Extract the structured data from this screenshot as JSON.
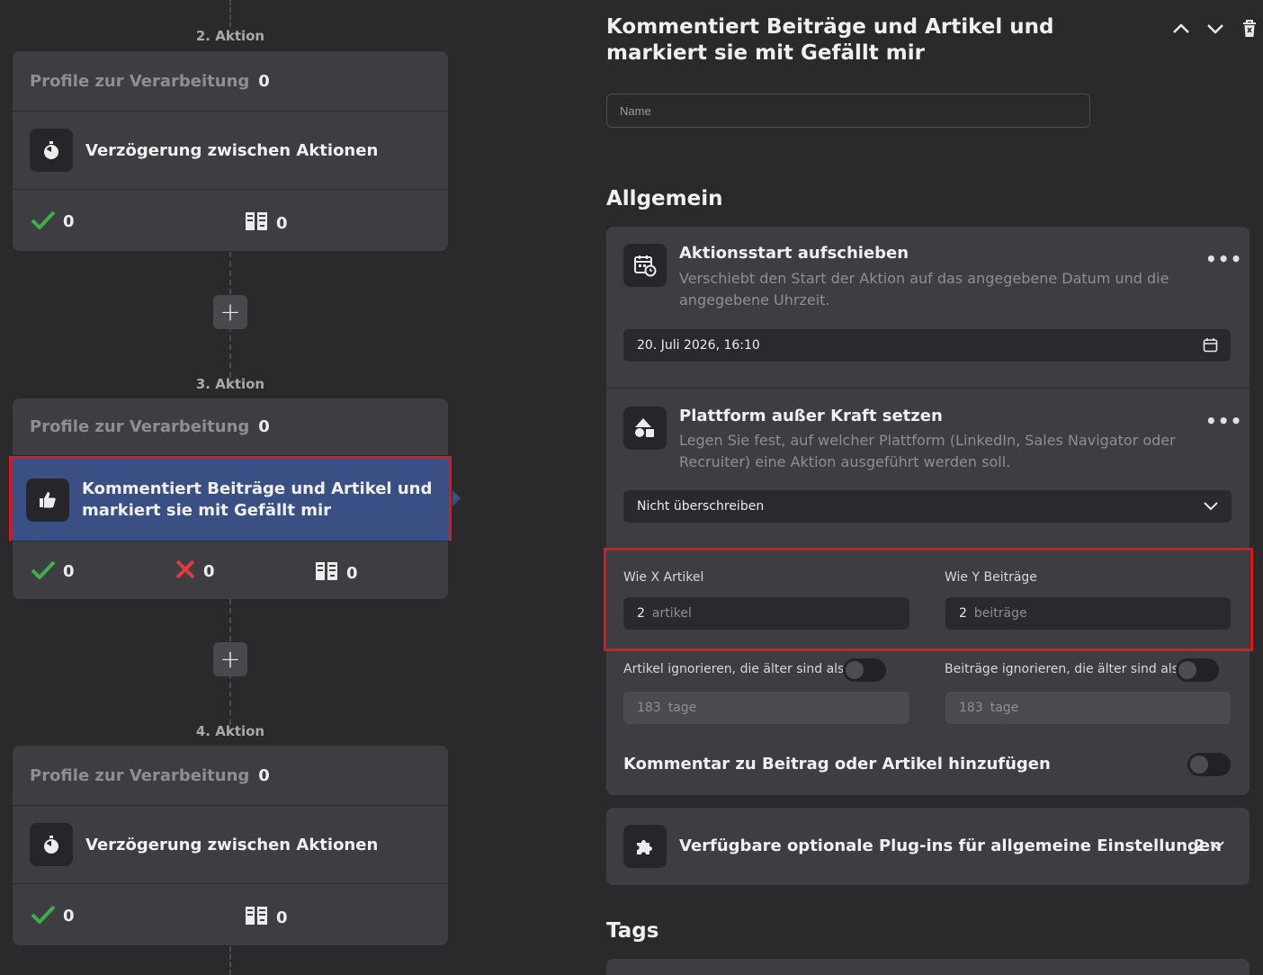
{
  "flow": {
    "steps": [
      {
        "label": "2. Aktion",
        "profiles_label": "Profile zur Verarbeitung",
        "profiles_count": "0",
        "action": "Verzögerung zwischen Aktionen",
        "success": "0",
        "skipped": "0"
      },
      {
        "label": "3. Aktion",
        "profiles_label": "Profile zur Verarbeitung",
        "profiles_count": "0",
        "action": "Kommentiert Beiträge und Artikel und markiert sie mit Gefällt mir",
        "success": "0",
        "failed": "0",
        "skipped": "0"
      },
      {
        "label": "4. Aktion",
        "profiles_label": "Profile zur Verarbeitung",
        "profiles_count": "0",
        "action": "Verzögerung zwischen Aktionen",
        "success": "0",
        "skipped": "0"
      }
    ]
  },
  "panel": {
    "title": "Kommentiert Beiträge und Artikel und markiert sie mit Gefällt mir",
    "name_placeholder": "Name",
    "general_heading": "Allgemein",
    "delay_start": {
      "title": "Aktionsstart aufschieben",
      "description": "Verschiebt den Start der Aktion auf das angegebene Datum und die angegebene Uhrzeit.",
      "date_value": "20. Juli 2026, 16:10"
    },
    "platform": {
      "title": "Plattform außer Kraft setzen",
      "description": "Legen Sie fest, auf welcher Plattform (LinkedIn, Sales Navigator oder Recruiter) eine Aktion ausgeführt werden soll.",
      "selected": "Nicht überschreiben"
    },
    "like_x_articles": {
      "label": "Wie X Artikel",
      "value": "2",
      "unit": "artikel"
    },
    "like_y_posts": {
      "label": "Wie Y Beiträge",
      "value": "2",
      "unit": "beiträge"
    },
    "ignore_articles": {
      "label": "Artikel ignorieren, die älter sind als",
      "value": "183",
      "unit": "tage"
    },
    "ignore_posts": {
      "label": "Beiträge ignorieren, die älter sind als",
      "value": "183",
      "unit": "tage"
    },
    "comment_toggle_label": "Kommentar zu Beitrag oder Artikel hinzufügen",
    "plugins": {
      "label": "Verfügbare optionale Plug-ins für allgemeine Einstellungen",
      "count": "2"
    },
    "tags_heading": "Tags"
  },
  "colors": {
    "accent_active": "#3a5084",
    "highlight_border": "#e0161b",
    "success": "#3fae4b",
    "fail": "#e0393e"
  }
}
